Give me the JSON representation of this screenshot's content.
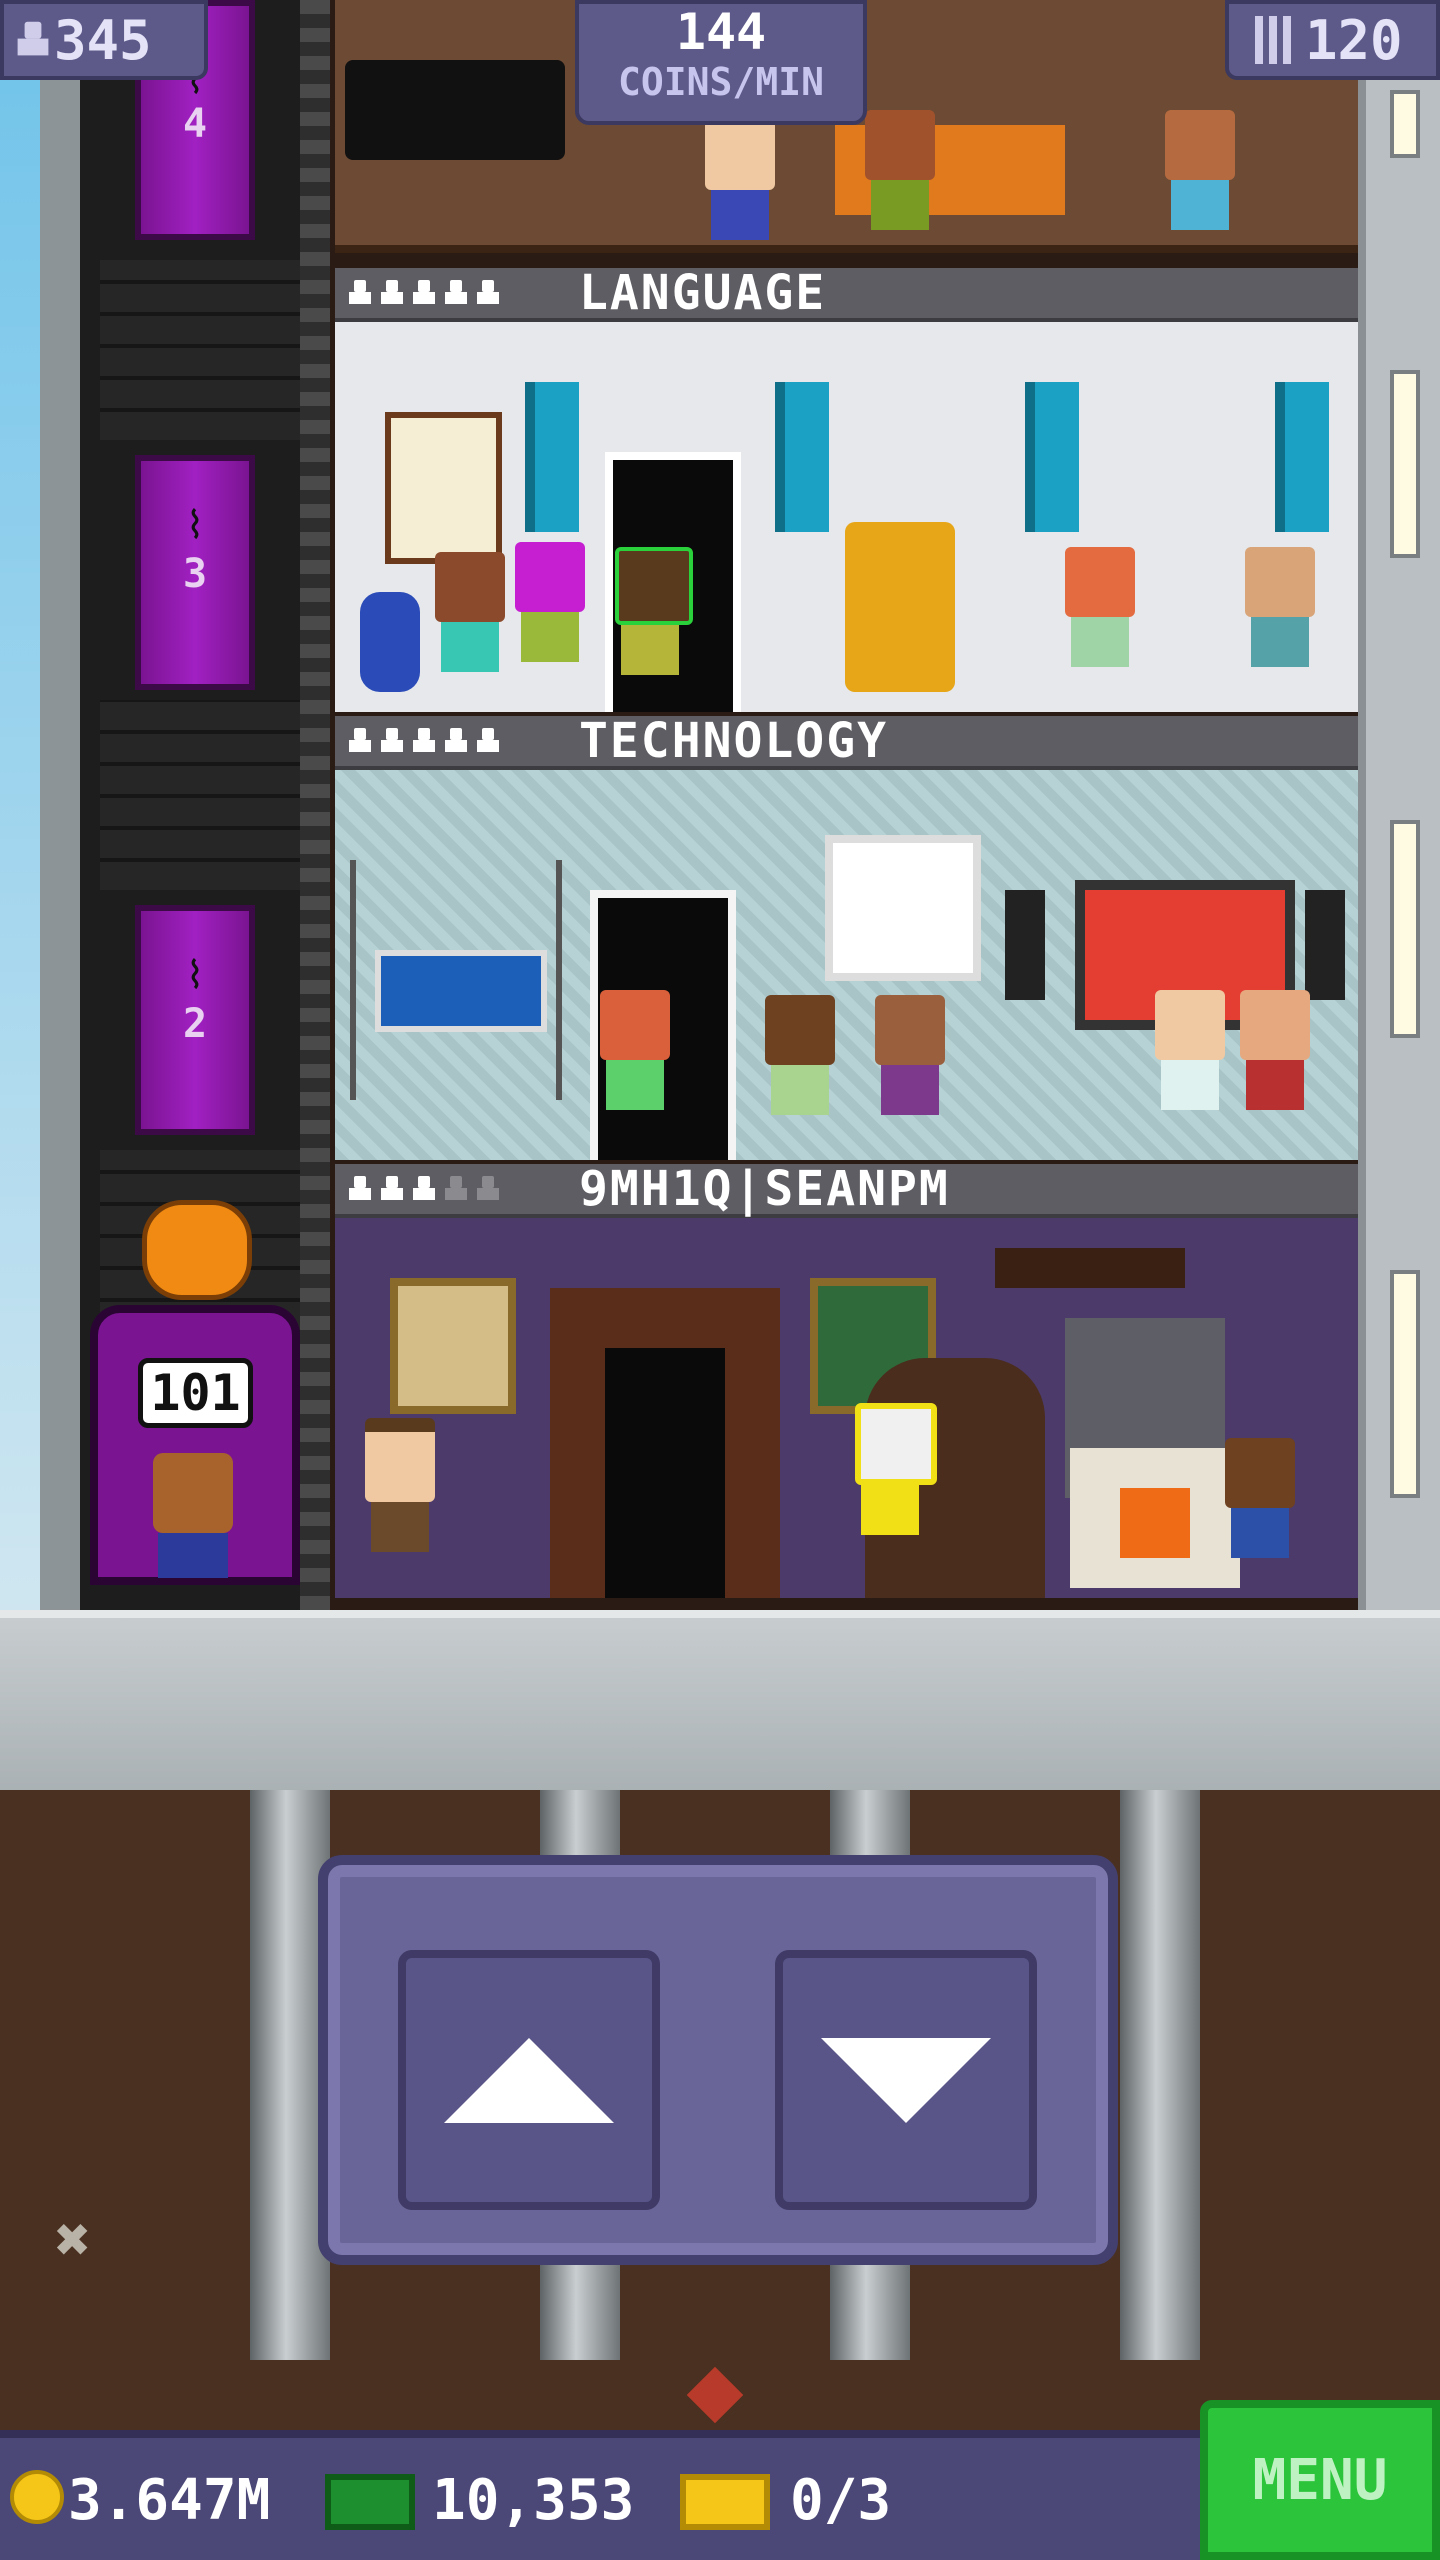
{
  "hud": {
    "population": "345",
    "coins_rate_value": "144",
    "coins_rate_unit": "COINS/MIN",
    "floors": "120"
  },
  "floors": [
    {
      "name": "LANGUAGE",
      "stars_filled": 5,
      "stars_total": 5
    },
    {
      "name": "TECHNOLOGY",
      "stars_filled": 5,
      "stars_total": 5
    },
    {
      "name": "9MH1Q|SEANPM",
      "stars_filled": 3,
      "stars_total": 5
    }
  ],
  "elevator": {
    "floor_labels": [
      "4",
      "3",
      "2"
    ],
    "current_floor": "101"
  },
  "bottom_bar": {
    "coins": "3.647M",
    "bux": "10,353",
    "vip": "0/3",
    "menu_label": "MENU"
  },
  "colors": {
    "elevator_purple": "#a120c2",
    "panel": "#6a6598",
    "menu_green": "#2bc43a",
    "coin_gold": "#f5c518",
    "bux_green": "#1e8f2e"
  },
  "icons": [
    "person-icon",
    "building-icon",
    "coin-icon",
    "bux-icon",
    "vip-ticket-icon",
    "up-arrow-icon",
    "down-arrow-icon",
    "pumpkin-icon",
    "bat-icon"
  ]
}
